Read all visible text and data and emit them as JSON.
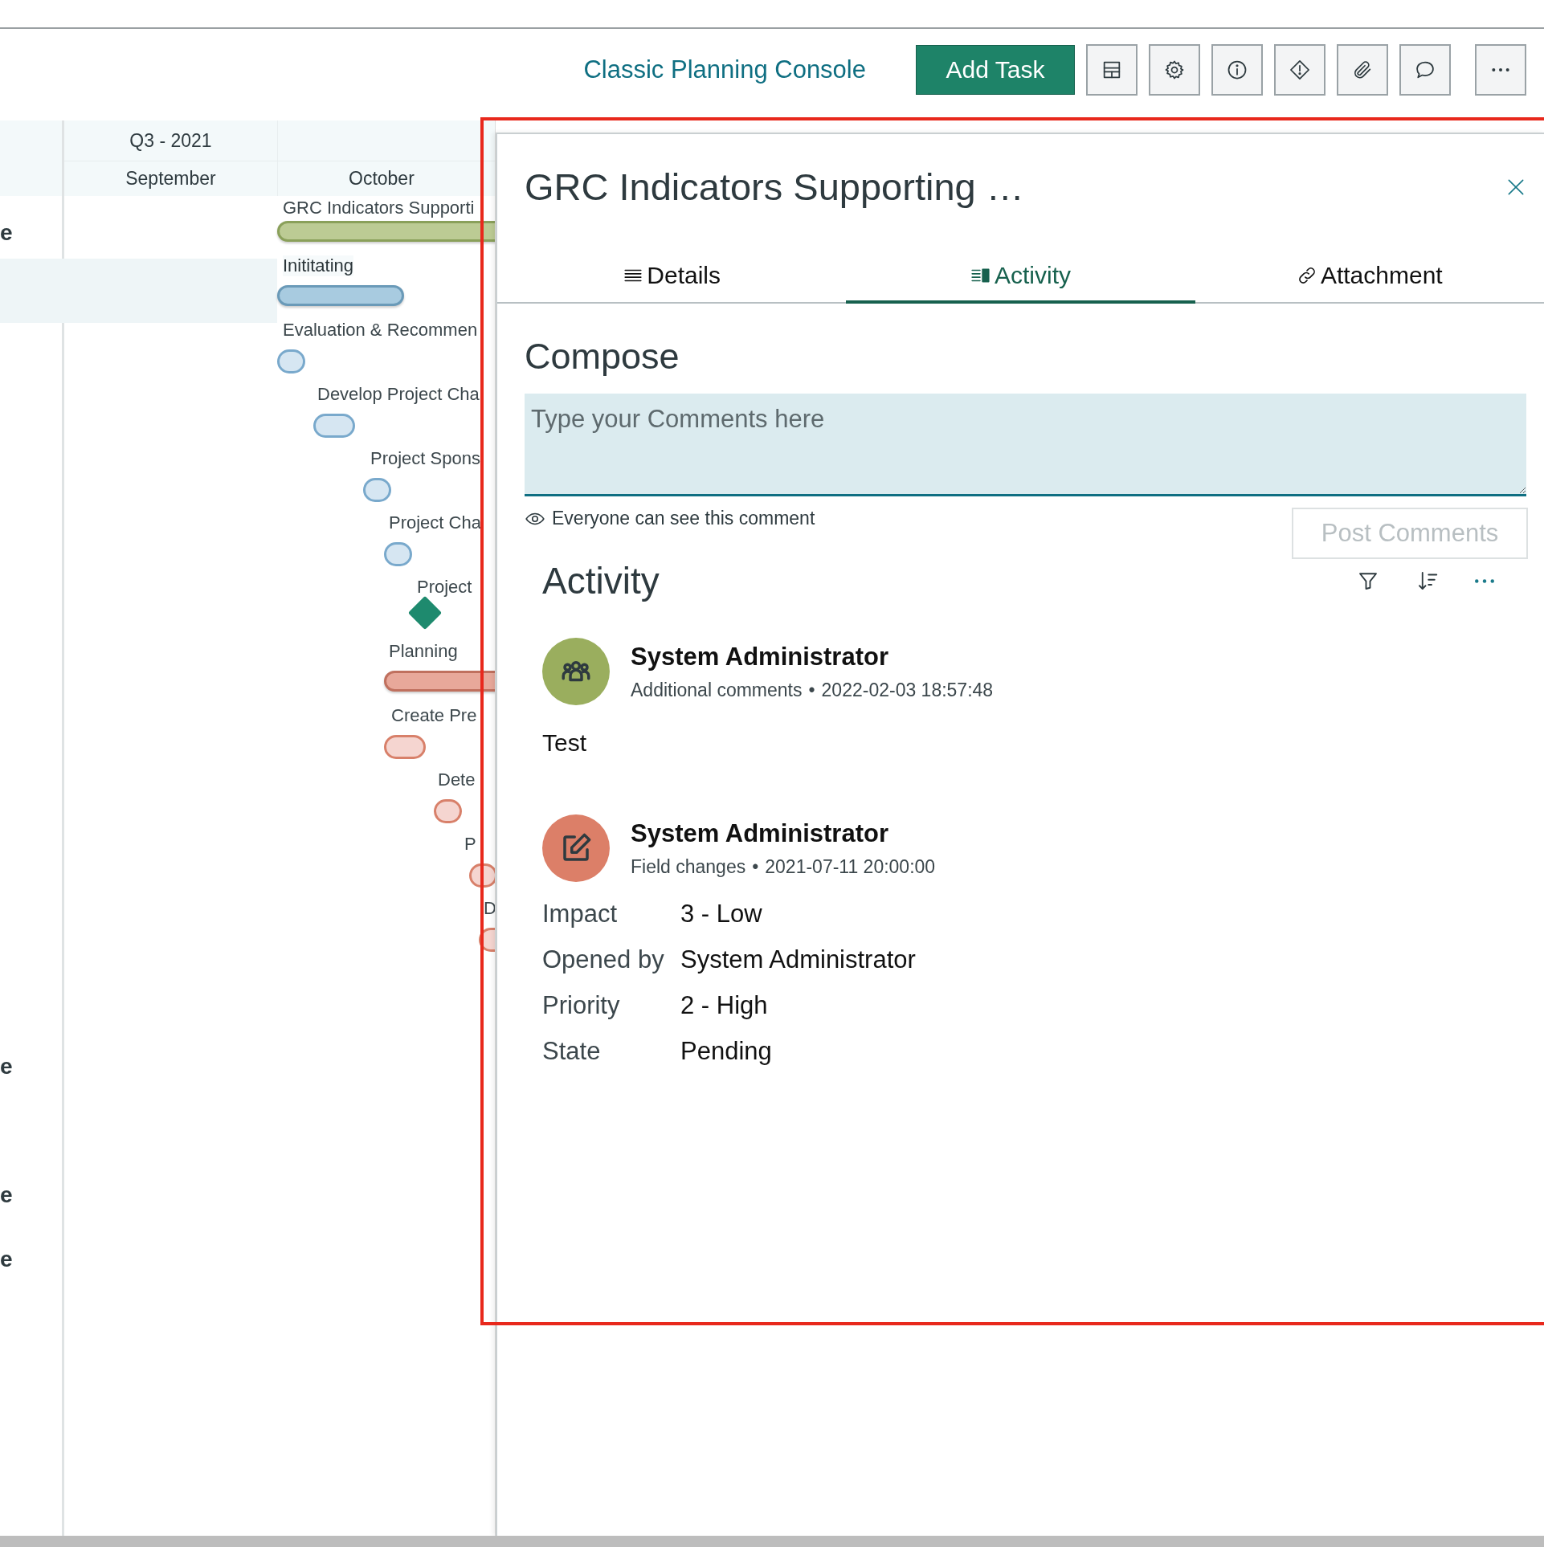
{
  "toolbar": {
    "title": "Classic Planning Console",
    "primary_button": "Add Task",
    "icon_buttons": [
      {
        "kind": "layout"
      },
      {
        "kind": "settings"
      },
      {
        "kind": "info"
      },
      {
        "kind": "alert"
      },
      {
        "kind": "attach"
      },
      {
        "kind": "comment"
      },
      {
        "kind": "more"
      }
    ]
  },
  "gantt": {
    "quarter": "Q3 - 2021",
    "months": [
      "September",
      "October"
    ],
    "left_column_fragments": [
      "e",
      "e",
      "e",
      "e"
    ],
    "tasks": [
      {
        "label": "GRC Indicators Supporti",
        "kind": "bar",
        "color": "#bccb94",
        "selected": false
      },
      {
        "label": "Inititating",
        "kind": "bar",
        "color": "#a8cbe0",
        "selected": true
      },
      {
        "label": "Evaluation & Recommen",
        "kind": "dot",
        "color": "#d6e6f2",
        "selected": false
      },
      {
        "label": "Develop Project Cha",
        "kind": "pill",
        "color": "#d6e6f2",
        "selected": false
      },
      {
        "label": "Project Spons",
        "kind": "dot",
        "color": "#d6e6f2",
        "selected": false
      },
      {
        "label": "Project Cha",
        "kind": "dot",
        "color": "#d6e6f2",
        "selected": false
      },
      {
        "label": "Project",
        "kind": "milestone",
        "color": "#1e8a6e",
        "selected": false
      },
      {
        "label": "Planning",
        "kind": "bar",
        "color": "#e8a89a",
        "selected": false
      },
      {
        "label": "Create Pre",
        "kind": "pill",
        "color": "#f5d5d0",
        "selected": false
      },
      {
        "label": "Dete",
        "kind": "dot",
        "color": "#f5d5d0",
        "selected": false
      },
      {
        "label": "P",
        "kind": "dot",
        "color": "#f5d5d0",
        "selected": false
      },
      {
        "label": "D",
        "kind": "dot",
        "color": "#f5d5d0",
        "selected": false
      }
    ]
  },
  "highlight_frame": true,
  "panel": {
    "title": "GRC Indicators Supporting …",
    "tabs": [
      {
        "label": "Details",
        "kind": "details",
        "selected": false
      },
      {
        "label": "Activity",
        "kind": "activity",
        "selected": true
      },
      {
        "label": "Attachment",
        "kind": "attachment",
        "selected": false
      }
    ],
    "compose": {
      "heading": "Compose",
      "placeholder": "Type your Comments here",
      "visibility_note": "Everyone can see this comment",
      "post_button": "Post Comments",
      "post_disabled": true
    },
    "activity": {
      "heading": "Activity",
      "entries": [
        {
          "kind": "comment",
          "color": "#9aae5e",
          "author": "System Administrator",
          "type": "Additional comments",
          "separator": "•",
          "time": "2022-02-03 18:57:48",
          "body": "Test"
        },
        {
          "kind": "field_changes",
          "color": "#dc7f68",
          "author": "System Administrator",
          "type": "Field changes",
          "separator": "•",
          "time": "2021-07-11 20:00:00",
          "fields": [
            {
              "name": "Impact",
              "value": "3 - Low"
            },
            {
              "name": "Opened by",
              "value": "System Administrator"
            },
            {
              "name": "Priority",
              "value": "2 - High"
            },
            {
              "name": "State",
              "value": "Pending"
            }
          ]
        }
      ]
    }
  }
}
